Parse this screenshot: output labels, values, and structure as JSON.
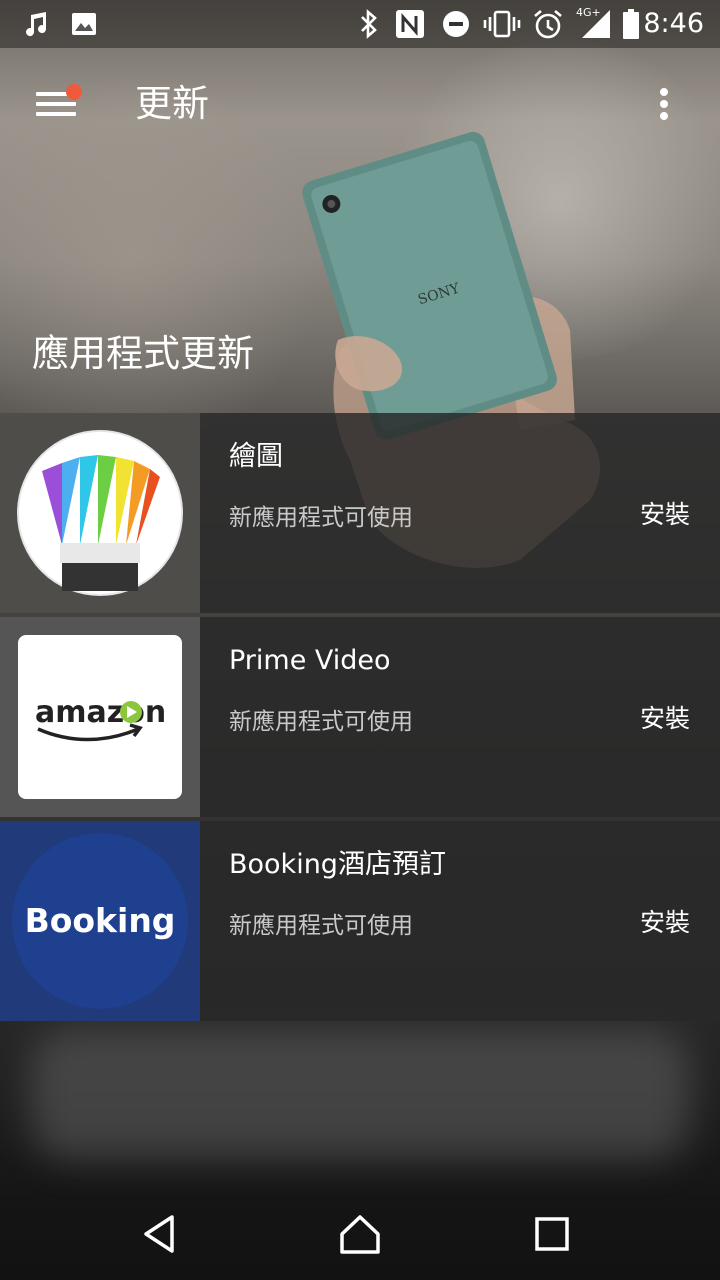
{
  "status_bar": {
    "time": "8:46",
    "network_label": "4G+",
    "icons": [
      "music-note-icon",
      "image-icon",
      "bluetooth-icon",
      "nfc-icon",
      "do-not-disturb-icon",
      "vibrate-icon",
      "alarm-icon",
      "signal-icon",
      "battery-icon"
    ]
  },
  "appbar": {
    "title": "更新",
    "notification_dot_color": "#ef5a3c"
  },
  "section": {
    "title": "應用程式更新"
  },
  "apps": [
    {
      "name": "繪圖",
      "status": "新應用程式可使用",
      "action": "安裝",
      "icon": "sketch-icon"
    },
    {
      "name": "Prime Video",
      "status": "新應用程式可使用",
      "action": "安裝",
      "icon": "amazon-logo",
      "logo_text": "amazon"
    },
    {
      "name": "Booking酒店預訂",
      "status": "新應用程式可使用",
      "action": "安裝",
      "icon": "booking-logo",
      "logo_text": "Booking"
    }
  ],
  "nav": {
    "icons": [
      "back-icon",
      "home-icon",
      "recents-icon"
    ]
  }
}
